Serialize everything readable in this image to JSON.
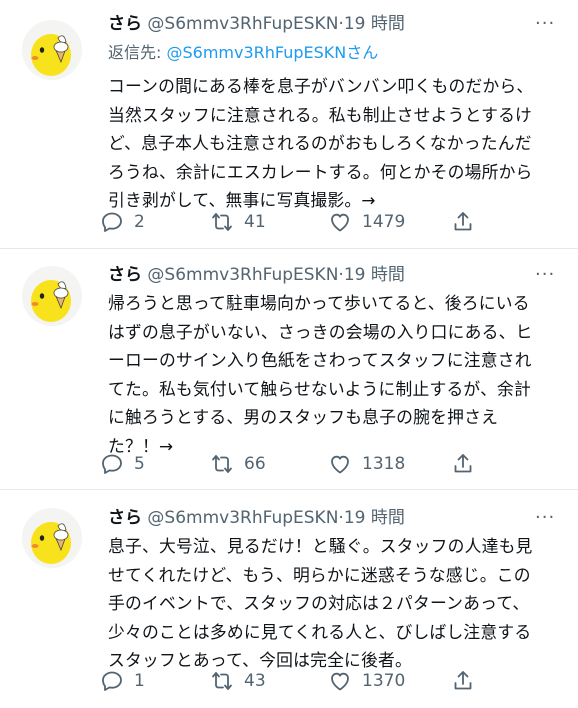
{
  "tweets": [
    {
      "name": "さら",
      "handle": "@S6mmv3RhFupESKN",
      "dot": "·",
      "time": "19 時間",
      "more": "···",
      "reply_prefix": "返信先: ",
      "reply_mention": "@S6mmv3RhFupESKN",
      "reply_suffix": "さん",
      "lines": [
        "コーンの間にある棒を息子がバンバン叩くものだから、",
        "当然スタッフに注意される。私も制止させようとするけ",
        "ど、息子本人も注意されるのがおもしろくなかったんだ",
        "ろうね、余計にエスカレートする。何とかその場所から",
        "引き剥がして、無事に写真撮影。→"
      ],
      "replies": "2",
      "retweets": "41",
      "likes": "1479"
    },
    {
      "name": "さら",
      "handle": "@S6mmv3RhFupESKN",
      "dot": "·",
      "time": "19 時間",
      "more": "···",
      "lines": [
        "帰ろうと思って駐車場向かって歩いてると、後ろにいる",
        "はずの息子がいない、さっきの会場の入り口にある、ヒ",
        "ーローのサイン入り色紙をさわってスタッフに注意され",
        "てた。私も気付いて触らせないように制止するが、余計",
        "に触ろうとする、男のスタッフも息子の腕を押さえ",
        "た？！→"
      ],
      "replies": "5",
      "retweets": "66",
      "likes": "1318"
    },
    {
      "name": "さら",
      "handle": "@S6mmv3RhFupESKN",
      "dot": "·",
      "time": "19 時間",
      "more": "···",
      "lines": [
        "息子、大号泣、見るだけ！と騒ぐ。スタッフの人達も見",
        "せてくれたけど、もう、明らかに迷惑そうな感じ。この",
        "手のイベントで、スタッフの対応は２パターンあって、",
        "少々のことは多めに見てくれる人と、びしばし注意する",
        "スタッフとあって、今回は完全に後者。"
      ],
      "replies": "1",
      "retweets": "43",
      "likes": "1370"
    }
  ]
}
